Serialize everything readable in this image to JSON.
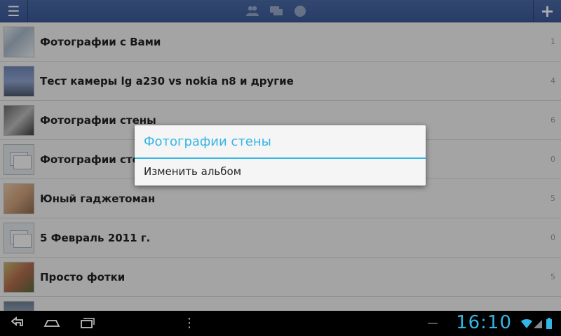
{
  "topbar": {
    "menu_icon": "menu-icon",
    "center_icons": [
      "friends-icon",
      "messages-icon",
      "globe-icon"
    ],
    "add_icon": "plus-icon"
  },
  "albums": [
    {
      "title": "Фотографии с Вами",
      "count": "1",
      "thumb": "photo1"
    },
    {
      "title": "Тест камеры lg a230 vs nokia n8 и другие",
      "count": "4",
      "thumb": "photo2"
    },
    {
      "title": "Фотографии стены",
      "count": "6",
      "thumb": "photo3"
    },
    {
      "title": "Фотографии стены",
      "count": "0",
      "thumb": "placeholder"
    },
    {
      "title": "Юный гаджетоман",
      "count": "5",
      "thumb": "photo4"
    },
    {
      "title": "5 Февраль 2011 г.",
      "count": "0",
      "thumb": "placeholder"
    },
    {
      "title": "Просто фотки",
      "count": "5",
      "thumb": "photo5"
    },
    {
      "title": "",
      "count": "",
      "thumb": "photo6"
    }
  ],
  "dialog": {
    "title": "Фотографии стены",
    "items": [
      "Изменить альбом"
    ]
  },
  "system_bar": {
    "clock": "16:10",
    "accent_color": "#33b5e5"
  }
}
